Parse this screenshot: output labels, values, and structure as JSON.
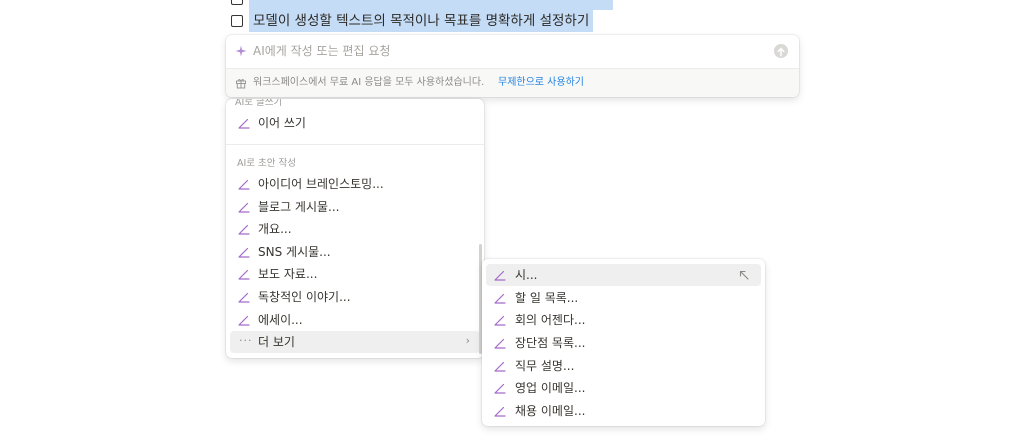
{
  "checklist": {
    "partial_item_label": "",
    "item_label": "모델이 생성할 텍스트의 목적이나 목표를 명확하게 설정하기"
  },
  "ai_prompt": {
    "placeholder": "AI에게 작성 또는 편집 요청",
    "footer_text": "워크스페이스에서 무료 AI 응답을 모두 사용하셨습니다.",
    "footer_link": "무제한으로 사용하기"
  },
  "menu": {
    "cut_section_label": "AI로 글쓰기",
    "top_items": [
      {
        "label": "이어 쓰기",
        "icon": "pen-icon"
      }
    ],
    "draft_heading": "AI로 초안 작성",
    "draft_items": [
      {
        "label": "아이디어 브레인스토밍...",
        "icon": "pen-icon"
      },
      {
        "label": "블로그 게시물...",
        "icon": "pen-icon"
      },
      {
        "label": "개요...",
        "icon": "pen-icon"
      },
      {
        "label": "SNS 게시물...",
        "icon": "pen-icon"
      },
      {
        "label": "보도 자료...",
        "icon": "pen-icon"
      },
      {
        "label": "독창적인 이야기...",
        "icon": "pen-icon"
      },
      {
        "label": "에세이...",
        "icon": "pen-icon"
      }
    ],
    "more": {
      "label": "더 보기",
      "icon": "more-dots-icon",
      "chevron": "›"
    }
  },
  "submenu": {
    "items": [
      {
        "label": "시...",
        "icon": "pen-icon",
        "selected": true
      },
      {
        "label": "할 일 목록...",
        "icon": "pen-icon"
      },
      {
        "label": "회의 어젠다...",
        "icon": "pen-icon"
      },
      {
        "label": "장단점 목록...",
        "icon": "pen-icon"
      },
      {
        "label": "직무 설명...",
        "icon": "pen-icon"
      },
      {
        "label": "영업 이메일...",
        "icon": "pen-icon"
      },
      {
        "label": "채용 이메일...",
        "icon": "pen-icon"
      }
    ]
  },
  "colors": {
    "accent_purple": "#a56acb",
    "link_blue": "#2383e2",
    "selection_blue": "#c5dcf6"
  }
}
